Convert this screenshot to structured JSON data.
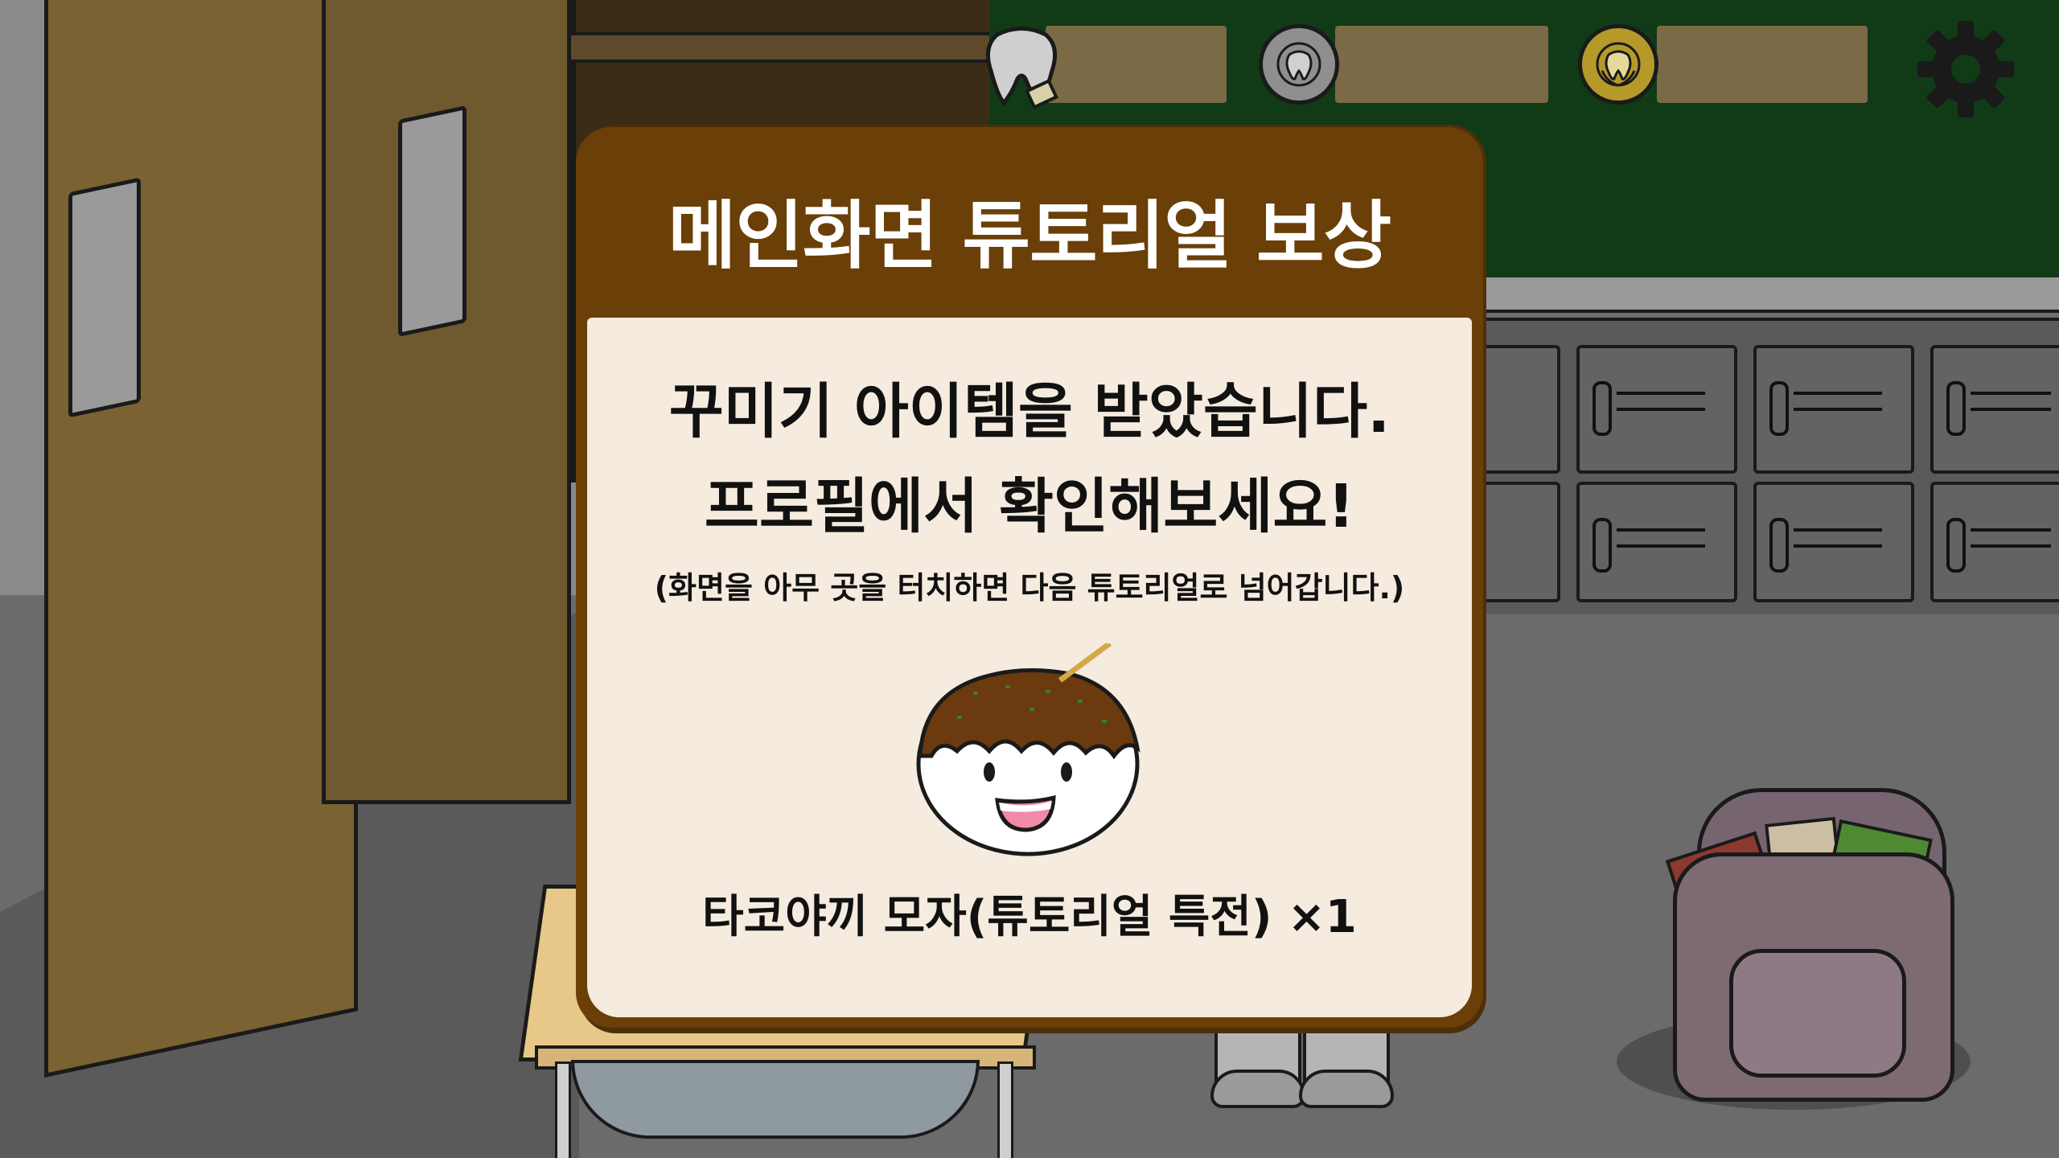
{
  "hud": {
    "currencies": [
      {
        "name": "tooth-currency",
        "value": ""
      },
      {
        "name": "silver-tooth-coin",
        "value": ""
      },
      {
        "name": "gold-tooth-coin",
        "value": ""
      }
    ]
  },
  "modal": {
    "title": "메인화면 튜토리얼 보상",
    "message_line1": "꾸미기 아이템을 받았습니다.",
    "message_line2": "프로필에서 확인해보세요!",
    "hint": "(화면을 아무 곳을 터치하면 다음 튜토리얼로 넘어갑니다.)",
    "reward": {
      "name": "타코야끼 모자(튜토리얼 특전) ×1",
      "icon": "takoyaki-hat-icon"
    }
  },
  "colors": {
    "modal_frame": "#6a3f08",
    "modal_body": "#f5ebde",
    "chalkboard": "#113a17",
    "hud_bar": "#7a6a45"
  }
}
